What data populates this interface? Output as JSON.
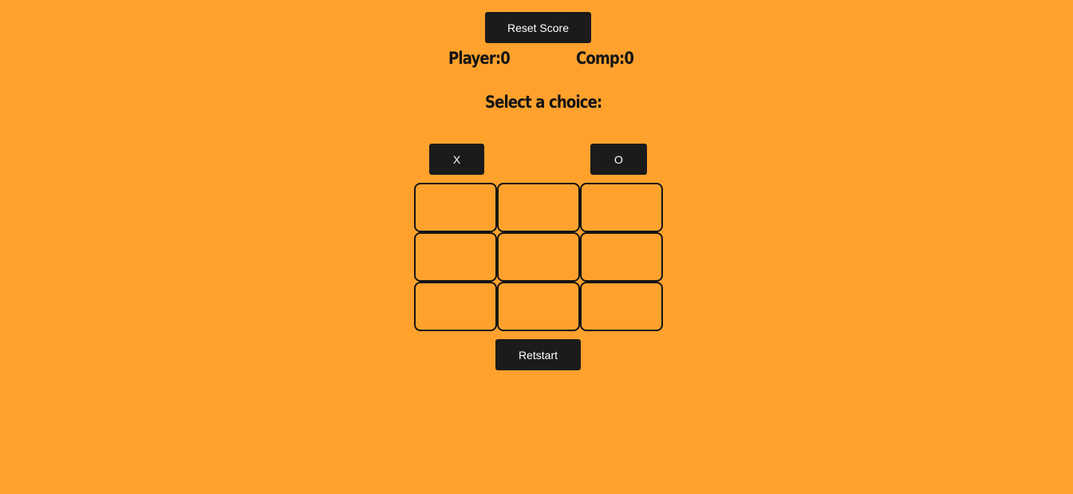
{
  "controls": {
    "reset_score_label": "Reset Score",
    "restart_label": "Retstart"
  },
  "score": {
    "player_label": "Player:",
    "player_value": "0",
    "comp_label": "Comp:",
    "comp_value": "0"
  },
  "prompt": "Select a choice:",
  "choices": {
    "x_label": "X",
    "o_label": "O"
  },
  "board": {
    "cells": [
      "",
      "",
      "",
      "",
      "",
      "",
      "",
      "",
      ""
    ]
  },
  "colors": {
    "background": "#FFA22D",
    "button": "#1b1b1b",
    "button_text": "#ffffff",
    "ink": "#141414"
  }
}
